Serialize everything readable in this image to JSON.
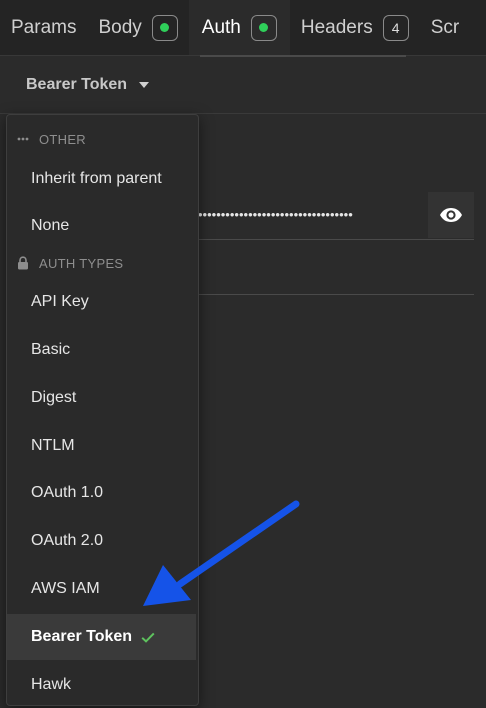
{
  "tabs": [
    {
      "label": "Params",
      "indicator": null
    },
    {
      "label": "Body",
      "indicator": "dot"
    },
    {
      "label": "Auth",
      "indicator": "dot",
      "active": true
    },
    {
      "label": "Headers",
      "indicator": "count",
      "count": "4"
    },
    {
      "label": "Scr",
      "indicator": null
    }
  ],
  "auth": {
    "selected_label": "Bearer Token"
  },
  "token": {
    "masked": "••••••••••••••••••••••••••••••••••"
  },
  "dropdown": {
    "other_header": "OTHER",
    "other_items": [
      "Inherit from parent",
      "None"
    ],
    "auth_types_header": "AUTH TYPES",
    "auth_type_items": [
      "API Key",
      "Basic",
      "Digest",
      "NTLM",
      "OAuth 1.0",
      "OAuth 2.0",
      "AWS IAM",
      "Bearer Token",
      "Hawk"
    ],
    "selected_item": "Bearer Token"
  },
  "colors": {
    "status_dot": "#2fcf5a",
    "check": "#5ec35e",
    "annotation_arrow": "#1553e8"
  },
  "icons": {
    "other_header": "more-dots-icon",
    "auth_types_header": "lock-icon",
    "reveal": "eye-icon",
    "selected": "check-icon",
    "select": "caret-down-icon"
  }
}
